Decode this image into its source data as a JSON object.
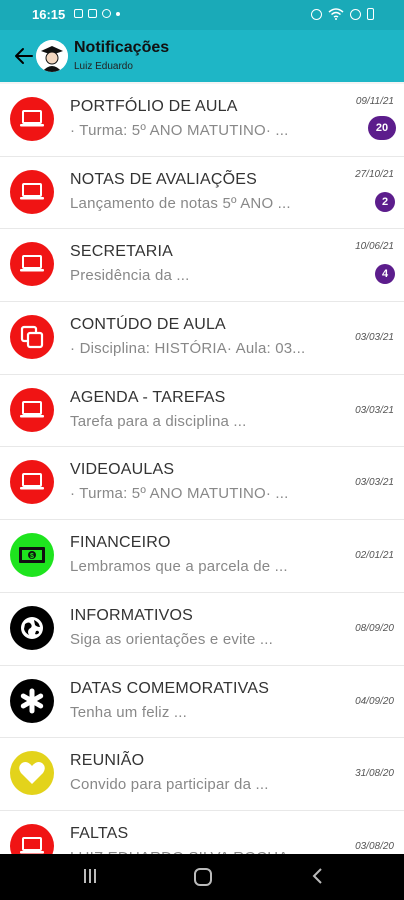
{
  "status": {
    "time": "16:15"
  },
  "header": {
    "title": "Notificações",
    "subtitle": "Luiz Eduardo"
  },
  "colors": {
    "red": "#f01414",
    "green": "#1ee41e",
    "black": "#000000",
    "yellow": "#e3d31b",
    "badge": "#5c1d8c",
    "teal": "#1eb6c6"
  },
  "items": [
    {
      "title": "PORTFÓLIO DE AULA",
      "subtitle": "· Turma: 5º ANO MATUTINO· ...",
      "date": "09/11/21",
      "badge": "20",
      "icon": "laptop-icon",
      "color": "red"
    },
    {
      "title": "NOTAS DE AVALIAÇÕES",
      "subtitle": "Lançamento de notas 5º ANO ...",
      "date": "27/10/21",
      "badge": "2",
      "icon": "laptop-icon",
      "color": "red"
    },
    {
      "title": "SECRETARIA",
      "subtitle": "Presidência da ...",
      "date": "10/06/21",
      "badge": "4",
      "icon": "laptop-icon",
      "color": "red"
    },
    {
      "title": "CONTÚDO DE AULA",
      "subtitle": "· Disciplina: HISTÓRIA· Aula: 03...",
      "date": "03/03/21",
      "badge": "",
      "icon": "copy-icon",
      "color": "red"
    },
    {
      "title": "AGENDA - TAREFAS",
      "subtitle": "Tarefa para a disciplina ...",
      "date": "03/03/21",
      "badge": "",
      "icon": "laptop-icon",
      "color": "red"
    },
    {
      "title": "VIDEOAULAS",
      "subtitle": "· Turma: 5º ANO MATUTINO· ...",
      "date": "03/03/21",
      "badge": "",
      "icon": "laptop-icon",
      "color": "red"
    },
    {
      "title": "FINANCEIRO",
      "subtitle": "Lembramos que a parcela de ...",
      "date": "02/01/21",
      "badge": "",
      "icon": "money-icon",
      "color": "green"
    },
    {
      "title": "INFORMATIVOS",
      "subtitle": "Siga as orientações e evite ...",
      "date": "08/09/20",
      "badge": "",
      "icon": "globe-icon",
      "color": "black"
    },
    {
      "title": "DATAS COMEMORATIVAS",
      "subtitle": "Tenha um feliz ...",
      "date": "04/09/20",
      "badge": "",
      "icon": "asterisk-icon",
      "color": "black"
    },
    {
      "title": "REUNIÃO",
      "subtitle": "Convido para participar da ...",
      "date": "31/08/20",
      "badge": "",
      "icon": "heart-icon",
      "color": "yellow"
    },
    {
      "title": "FALTAS",
      "subtitle": "LUIZ EDUARDO SILVA ROCHA",
      "date": "03/08/20",
      "badge": "",
      "icon": "laptop-icon",
      "color": "red"
    }
  ]
}
